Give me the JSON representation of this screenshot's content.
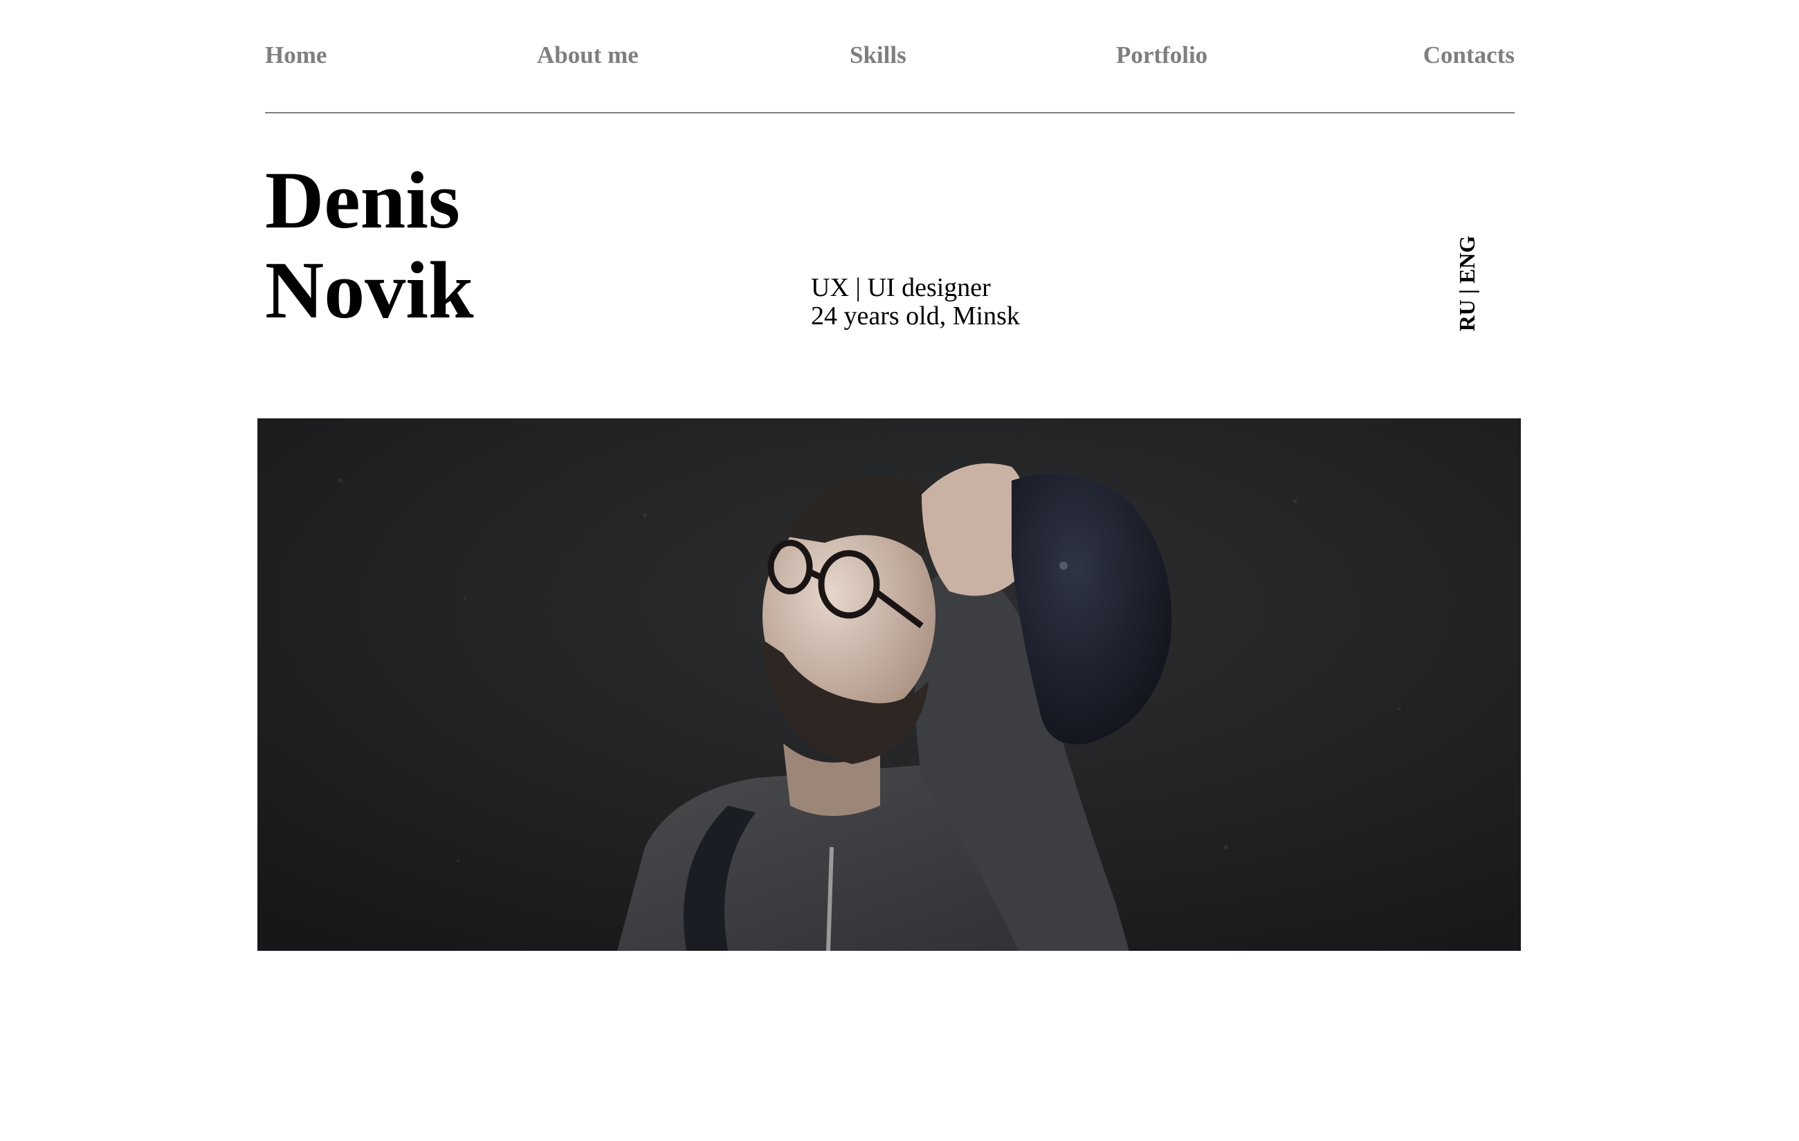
{
  "nav": {
    "items": [
      {
        "label": "Home"
      },
      {
        "label": "About me"
      },
      {
        "label": "Skills"
      },
      {
        "label": "Portfolio"
      },
      {
        "label": "Contacts"
      }
    ]
  },
  "hero": {
    "first_name": "Denis",
    "last_name": "Novik",
    "role": "UX | UI designer",
    "details": "24 years old, Minsk",
    "language_switch": "RU | ENG"
  },
  "photo": {
    "icon": "portrait-photo"
  },
  "colors": {
    "nav_text": "#7f7f7f",
    "text": "#000000",
    "rule": "#808080",
    "photo_bg": "#1f2022"
  }
}
